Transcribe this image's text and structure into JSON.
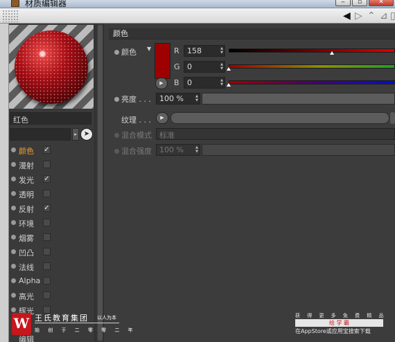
{
  "window": {
    "title": "材质编辑器"
  },
  "preview": {
    "material_name": "红色",
    "base_color": "#9e0000"
  },
  "channels": [
    {
      "label": "颜色",
      "checked": true,
      "active": true
    },
    {
      "label": "漫射",
      "checked": false,
      "active": false
    },
    {
      "label": "发光",
      "checked": true,
      "active": false
    },
    {
      "label": "透明",
      "checked": false,
      "active": false
    },
    {
      "label": "反射",
      "checked": true,
      "active": false
    },
    {
      "label": "环境",
      "checked": false,
      "active": false
    },
    {
      "label": "烟雾",
      "checked": false,
      "active": false
    },
    {
      "label": "凹凸",
      "checked": false,
      "active": false
    },
    {
      "label": "法线",
      "checked": false,
      "active": false
    },
    {
      "label": "Alpha",
      "checked": false,
      "active": false
    },
    {
      "label": "高光",
      "checked": false,
      "active": false
    },
    {
      "label": "辉光",
      "checked": false,
      "active": false
    }
  ],
  "channel_partial": "编辑",
  "color_section": {
    "header": "颜色",
    "color_label": "颜色",
    "r_label": "R",
    "r_value": "158",
    "r_fraction": 0.62,
    "g_label": "G",
    "g_value": "0",
    "g_fraction": 0.0,
    "b_label": "B",
    "b_value": "0",
    "b_fraction": 0.0,
    "brightness_label": "亮度 . . .",
    "brightness_value": "100 %",
    "texture_label": "纹理 . . .",
    "blend_mode_label": "混合模式",
    "blend_mode_value": "标准",
    "blend_strength_label": "混合强度",
    "blend_strength_value": "100 %"
  },
  "watermark": {
    "brand": "王氏教育集团",
    "slogan": "以人为本",
    "tagline": "始 创 于 二 零 零 二 年",
    "right_line1": "获 得 更 多 免 费 精 品 教 程",
    "right_line2": "绘 学 霸",
    "right_line3": "在AppStore或应用宝搜索下载"
  },
  "colors": {
    "accent": "#f0a030",
    "panel": "#3c3c3c",
    "swatch": "#9e0000"
  }
}
